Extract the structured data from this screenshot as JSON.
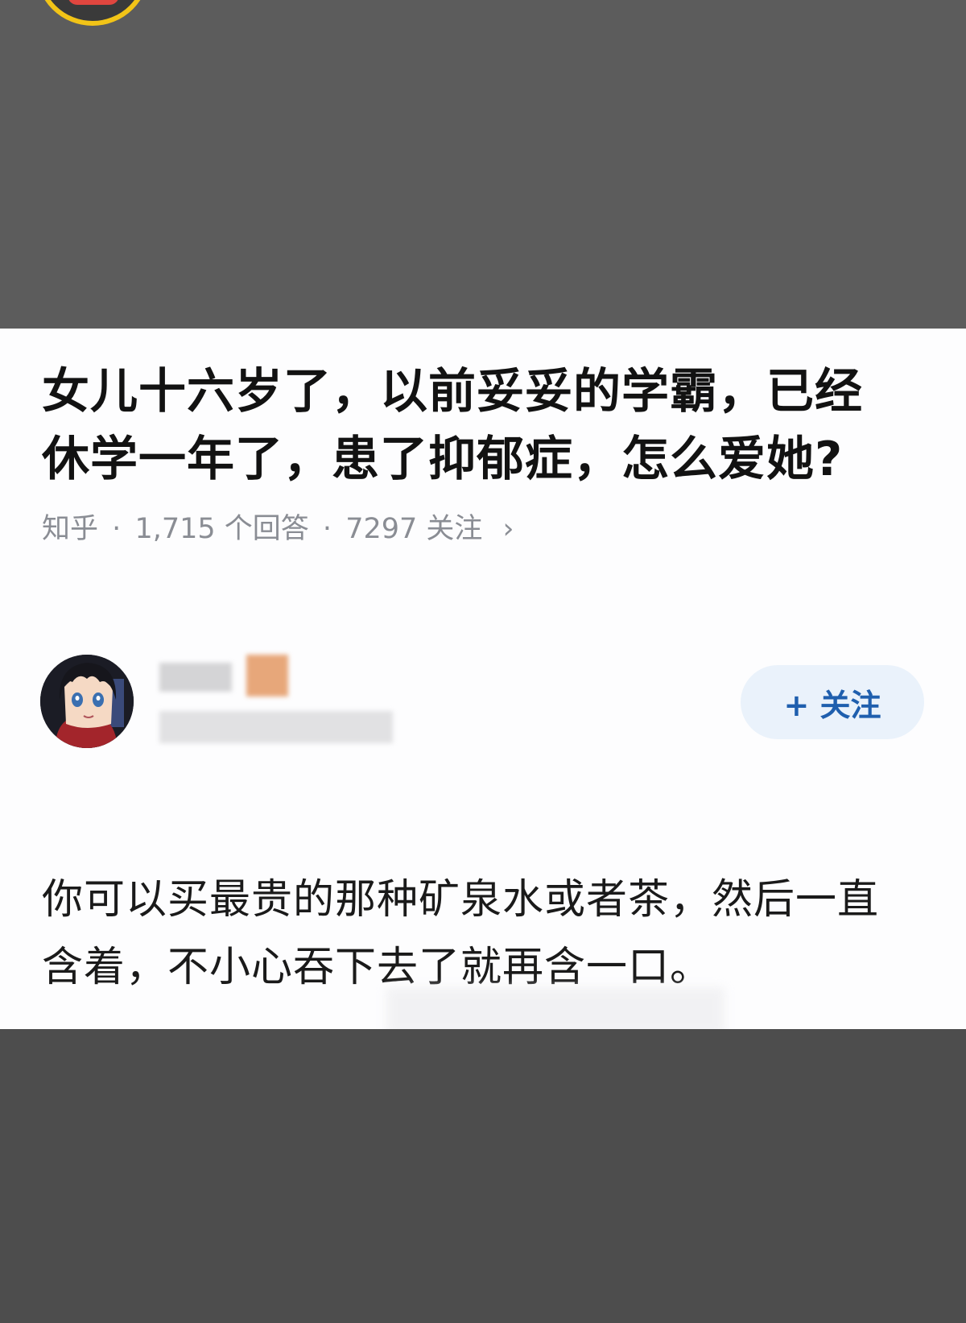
{
  "question": {
    "title": "女儿十六岁了，以前妥妥的学霸，已经休学一年了，患了抑郁症，怎么爱她?",
    "source": "知乎",
    "sep": "·",
    "answers": "1,715 个回答",
    "followers": "7297 关注",
    "chevron": "›"
  },
  "author": {
    "avatar_icon": "anime-avatar",
    "follow_label": "+ 关注"
  },
  "answer": {
    "text": "你可以买最贵的那种矿泉水或者茶，然后一直含着，不小心吞下去了就再含一口。"
  },
  "colors": {
    "card_bg": "#fdfdfe",
    "title": "#121212",
    "meta": "#8a8d94",
    "follow_bg": "#eaf2fb",
    "follow_text": "#1f5fae",
    "page_bg": "#5b5b5b",
    "badge_border": "#f2c417"
  }
}
